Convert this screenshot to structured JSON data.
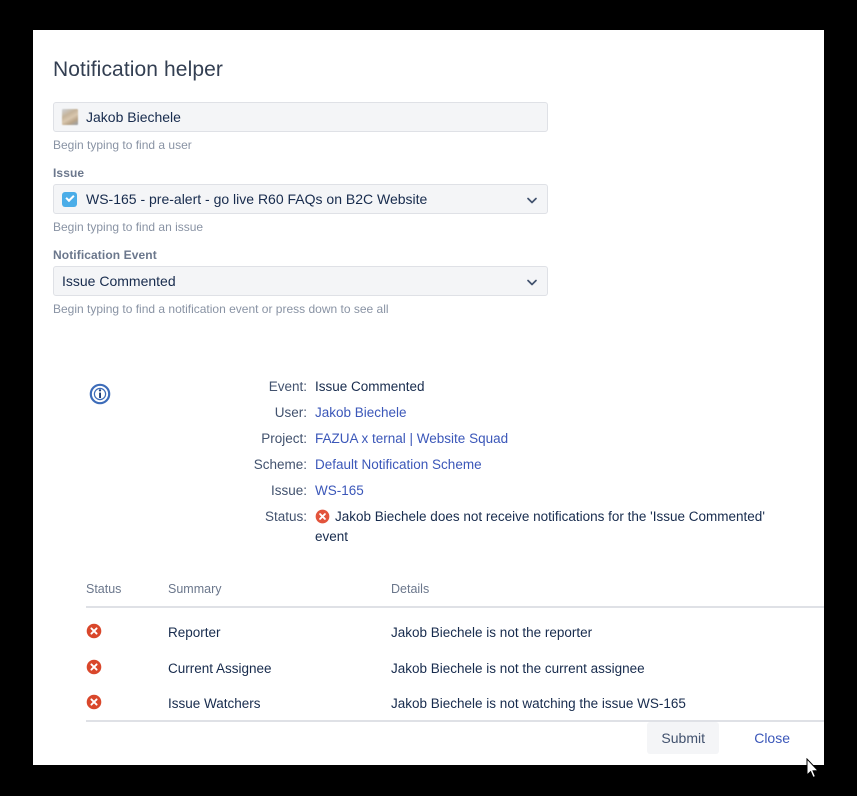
{
  "dialog": {
    "title": "Notification helper"
  },
  "form": {
    "user_field": {
      "value": "Jakob Biechele",
      "help": "Begin typing to find a user",
      "icon": "user-avatar"
    },
    "issue_field": {
      "label": "Issue",
      "value": "WS-165 - pre-alert - go live R60 FAQs on B2C Website",
      "help": "Begin typing to find an issue",
      "icon": "task-checkbox-icon"
    },
    "event_field": {
      "label": "Notification Event",
      "value": "Issue Commented",
      "help": "Begin typing to find a notification event or press down to see all"
    }
  },
  "info": {
    "icon": "info-circle-icon",
    "rows": [
      {
        "key": "Event:",
        "value": "Issue Commented",
        "link": false
      },
      {
        "key": "User:",
        "value": "Jakob Biechele",
        "link": true
      },
      {
        "key": "Project:",
        "value": "FAZUA x ternal | Website Squad",
        "link": true
      },
      {
        "key": "Scheme:",
        "value": "Default Notification Scheme",
        "link": true
      },
      {
        "key": "Issue:",
        "value": "WS-165",
        "link": true
      }
    ],
    "status": {
      "key": "Status:",
      "icon": "error-circle-icon",
      "value": "Jakob Biechele does not receive notifications for the 'Issue Commented' event"
    }
  },
  "table": {
    "headers": {
      "status": "Status",
      "summary": "Summary",
      "details": "Details"
    },
    "rows": [
      {
        "status_icon": "error-circle-icon",
        "summary": "Reporter",
        "details": "Jakob Biechele is not the reporter"
      },
      {
        "status_icon": "error-circle-icon",
        "summary": "Current Assignee",
        "details": "Jakob Biechele is not the current assignee"
      },
      {
        "status_icon": "error-circle-icon",
        "summary": "Issue Watchers",
        "details": "Jakob Biechele is not watching the issue WS-165"
      }
    ]
  },
  "footer": {
    "submit_label": "Submit",
    "close_label": "Close"
  },
  "colors": {
    "link": "#3b57b9",
    "error": "#e2543c",
    "info": "#3d6cb9",
    "task": "#4bade8",
    "label": "#6b778c",
    "text": "#172b4d",
    "field_bg": "#f4f5f7"
  }
}
